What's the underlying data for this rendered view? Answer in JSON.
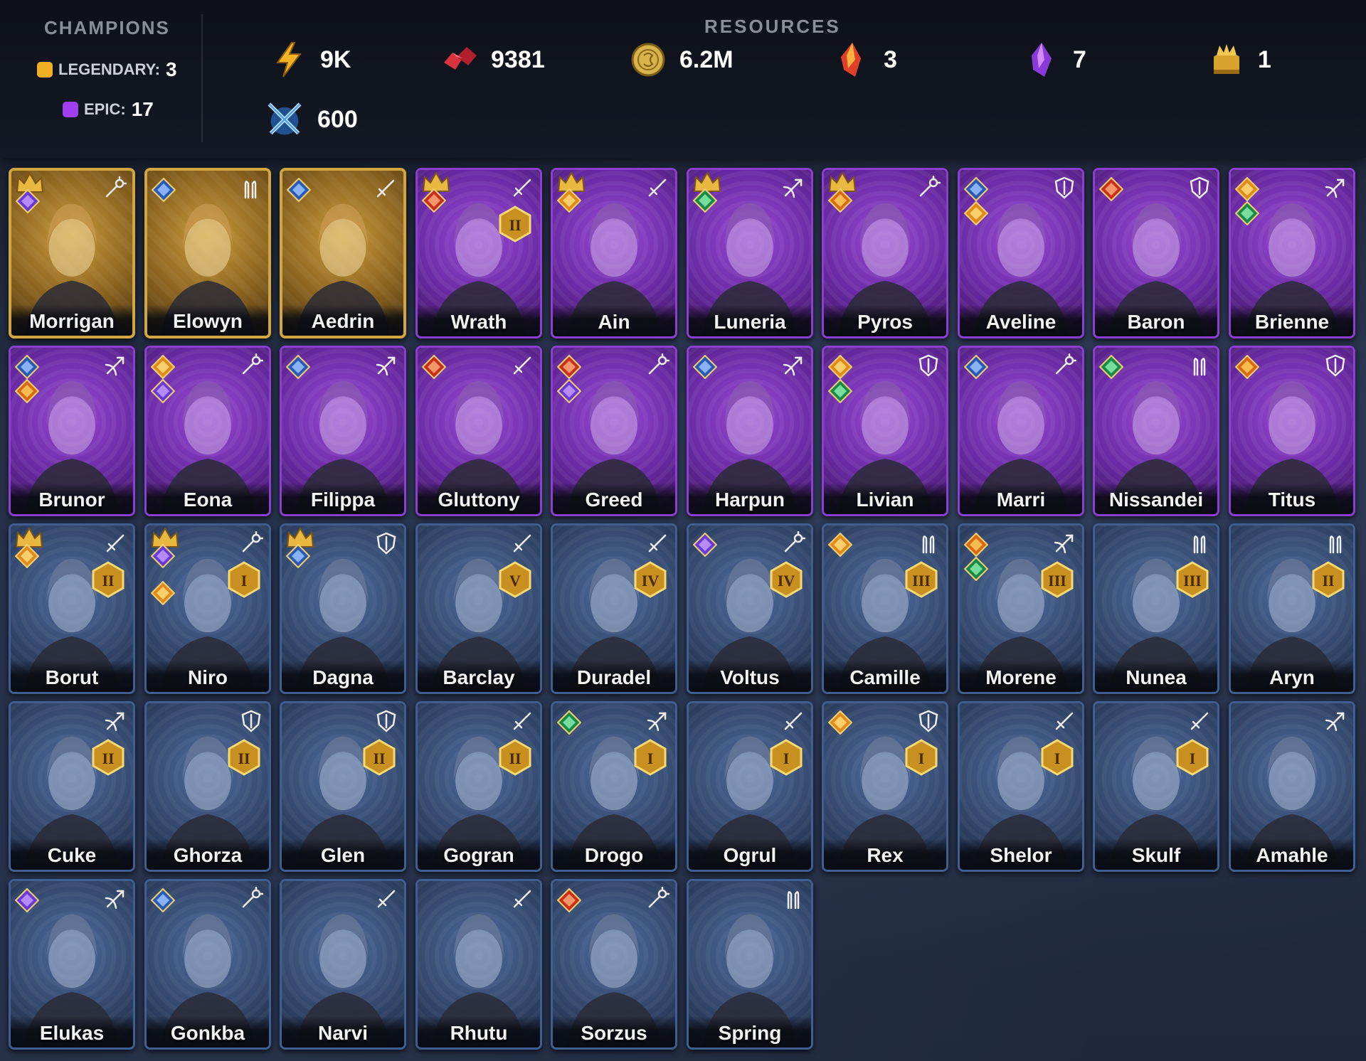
{
  "champions": {
    "title": "CHAMPIONS",
    "legendary_label": "LEGENDARY:",
    "legendary_count": "3",
    "epic_label": "EPIC:",
    "epic_count": "17",
    "legendary_color": "#f0b023",
    "epic_color": "#a03ef0"
  },
  "resources": {
    "title": "RESOURCES",
    "items": [
      {
        "icon": "energy-bolt-icon",
        "value": "9K"
      },
      {
        "icon": "rubies-icon",
        "value": "9381"
      },
      {
        "icon": "gold-coin-icon",
        "value": "6.2M"
      },
      {
        "icon": "red-shard-icon",
        "value": "3"
      },
      {
        "icon": "purple-shard-icon",
        "value": "7"
      },
      {
        "icon": "gold-trophy-icon",
        "value": "1"
      },
      {
        "icon": "arena-swords-icon",
        "value": "600"
      }
    ]
  },
  "roster": [
    {
      "name": "Morrigan",
      "rarity": "legendary",
      "role": "magic",
      "affinities": [
        "spirit"
      ],
      "crown": true,
      "rank": ""
    },
    {
      "name": "Elowyn",
      "rarity": "legendary",
      "role": "support",
      "affinities": [
        "magic"
      ],
      "crown": false,
      "rank": ""
    },
    {
      "name": "Aedrin",
      "rarity": "legendary",
      "role": "attack",
      "affinities": [
        "magic"
      ],
      "crown": false,
      "rank": ""
    },
    {
      "name": "Wrath",
      "rarity": "epic",
      "role": "attack",
      "affinities": [
        "force"
      ],
      "crown": true,
      "rank": "II"
    },
    {
      "name": "Ain",
      "rarity": "epic",
      "role": "attack",
      "affinities": [
        "void"
      ],
      "crown": true,
      "rank": ""
    },
    {
      "name": "Luneria",
      "rarity": "epic",
      "role": "ranged",
      "affinities": [
        "nature"
      ],
      "crown": true,
      "rank": ""
    },
    {
      "name": "Pyros",
      "rarity": "epic",
      "role": "magic",
      "affinities": [
        "fire"
      ],
      "crown": true,
      "rank": ""
    },
    {
      "name": "Aveline",
      "rarity": "epic",
      "role": "defense",
      "affinities": [
        "magic",
        "void"
      ],
      "crown": false,
      "rank": ""
    },
    {
      "name": "Baron",
      "rarity": "epic",
      "role": "defense",
      "affinities": [
        "force"
      ],
      "crown": false,
      "rank": ""
    },
    {
      "name": "Brienne",
      "rarity": "epic",
      "role": "ranged",
      "affinities": [
        "void",
        "nature"
      ],
      "crown": false,
      "rank": ""
    },
    {
      "name": "Brunor",
      "rarity": "epic",
      "role": "ranged",
      "affinities": [
        "magic",
        "fire"
      ],
      "crown": false,
      "rank": ""
    },
    {
      "name": "Eona",
      "rarity": "epic",
      "role": "magic",
      "affinities": [
        "void",
        "spirit"
      ],
      "crown": false,
      "rank": ""
    },
    {
      "name": "Filippa",
      "rarity": "epic",
      "role": "ranged",
      "affinities": [
        "magic"
      ],
      "crown": false,
      "rank": ""
    },
    {
      "name": "Gluttony",
      "rarity": "epic",
      "role": "attack",
      "affinities": [
        "force"
      ],
      "crown": false,
      "rank": ""
    },
    {
      "name": "Greed",
      "rarity": "epic",
      "role": "magic",
      "affinities": [
        "force",
        "spirit"
      ],
      "crown": false,
      "rank": ""
    },
    {
      "name": "Harpun",
      "rarity": "epic",
      "role": "ranged",
      "affinities": [
        "magic"
      ],
      "crown": false,
      "rank": ""
    },
    {
      "name": "Livian",
      "rarity": "epic",
      "role": "defense",
      "affinities": [
        "void",
        "nature"
      ],
      "crown": false,
      "rank": ""
    },
    {
      "name": "Marri",
      "rarity": "epic",
      "role": "magic",
      "affinities": [
        "magic"
      ],
      "crown": false,
      "rank": ""
    },
    {
      "name": "Nissandei",
      "rarity": "epic",
      "role": "support",
      "affinities": [
        "nature"
      ],
      "crown": false,
      "rank": ""
    },
    {
      "name": "Titus",
      "rarity": "epic",
      "role": "defense",
      "affinities": [
        "fire"
      ],
      "crown": false,
      "rank": ""
    },
    {
      "name": "Borut",
      "rarity": "rare",
      "role": "attack",
      "affinities": [
        "void"
      ],
      "crown": true,
      "rank": "II"
    },
    {
      "name": "Niro",
      "rarity": "rare",
      "role": "magic",
      "affinities": [
        "spirit",
        "void"
      ],
      "crown": true,
      "rank": "I"
    },
    {
      "name": "Dagna",
      "rarity": "rare",
      "role": "defense",
      "affinities": [
        "magic"
      ],
      "crown": true,
      "rank": ""
    },
    {
      "name": "Barclay",
      "rarity": "rare",
      "role": "attack",
      "affinities": [],
      "crown": false,
      "rank": "V"
    },
    {
      "name": "Duradel",
      "rarity": "rare",
      "role": "attack",
      "affinities": [],
      "crown": false,
      "rank": "IV"
    },
    {
      "name": "Voltus",
      "rarity": "rare",
      "role": "magic",
      "affinities": [
        "spirit"
      ],
      "crown": false,
      "rank": "IV"
    },
    {
      "name": "Camille",
      "rarity": "rare",
      "role": "support",
      "affinities": [
        "void"
      ],
      "crown": false,
      "rank": "III"
    },
    {
      "name": "Morene",
      "rarity": "rare",
      "role": "ranged",
      "affinities": [
        "fire",
        "nature"
      ],
      "crown": false,
      "rank": "III"
    },
    {
      "name": "Nunea",
      "rarity": "rare",
      "role": "support",
      "affinities": [],
      "crown": false,
      "rank": "III"
    },
    {
      "name": "Aryn",
      "rarity": "rare",
      "role": "support",
      "affinities": [],
      "crown": false,
      "rank": "II"
    },
    {
      "name": "Cuke",
      "rarity": "rare",
      "role": "ranged",
      "affinities": [],
      "crown": false,
      "rank": "II"
    },
    {
      "name": "Ghorza",
      "rarity": "rare",
      "role": "defense",
      "affinities": [],
      "crown": false,
      "rank": "II"
    },
    {
      "name": "Glen",
      "rarity": "rare",
      "role": "defense",
      "affinities": [],
      "crown": false,
      "rank": "II"
    },
    {
      "name": "Gogran",
      "rarity": "rare",
      "role": "attack",
      "affinities": [],
      "crown": false,
      "rank": "II"
    },
    {
      "name": "Drogo",
      "rarity": "rare",
      "role": "ranged",
      "affinities": [
        "nature"
      ],
      "crown": false,
      "rank": "I"
    },
    {
      "name": "Ogrul",
      "rarity": "rare",
      "role": "attack",
      "affinities": [],
      "crown": false,
      "rank": "I"
    },
    {
      "name": "Rex",
      "rarity": "rare",
      "role": "defense",
      "affinities": [
        "void"
      ],
      "crown": false,
      "rank": "I"
    },
    {
      "name": "Shelor",
      "rarity": "rare",
      "role": "attack",
      "affinities": [],
      "crown": false,
      "rank": "I"
    },
    {
      "name": "Skulf",
      "rarity": "rare",
      "role": "attack",
      "affinities": [],
      "crown": false,
      "rank": "I"
    },
    {
      "name": "Amahle",
      "rarity": "rare",
      "role": "ranged",
      "affinities": [],
      "crown": false,
      "rank": ""
    },
    {
      "name": "Elukas",
      "rarity": "rare",
      "role": "ranged",
      "affinities": [
        "spirit"
      ],
      "crown": false,
      "rank": ""
    },
    {
      "name": "Gonkba",
      "rarity": "rare",
      "role": "magic",
      "affinities": [
        "magic"
      ],
      "crown": false,
      "rank": ""
    },
    {
      "name": "Narvi",
      "rarity": "rare",
      "role": "attack",
      "affinities": [],
      "crown": false,
      "rank": ""
    },
    {
      "name": "Rhutu",
      "rarity": "rare",
      "role": "attack",
      "affinities": [],
      "crown": false,
      "rank": ""
    },
    {
      "name": "Sorzus",
      "rarity": "rare",
      "role": "magic",
      "affinities": [
        "force"
      ],
      "crown": false,
      "rank": ""
    },
    {
      "name": "Spring",
      "rarity": "rare",
      "role": "support",
      "affinities": [],
      "crown": false,
      "rank": ""
    }
  ]
}
